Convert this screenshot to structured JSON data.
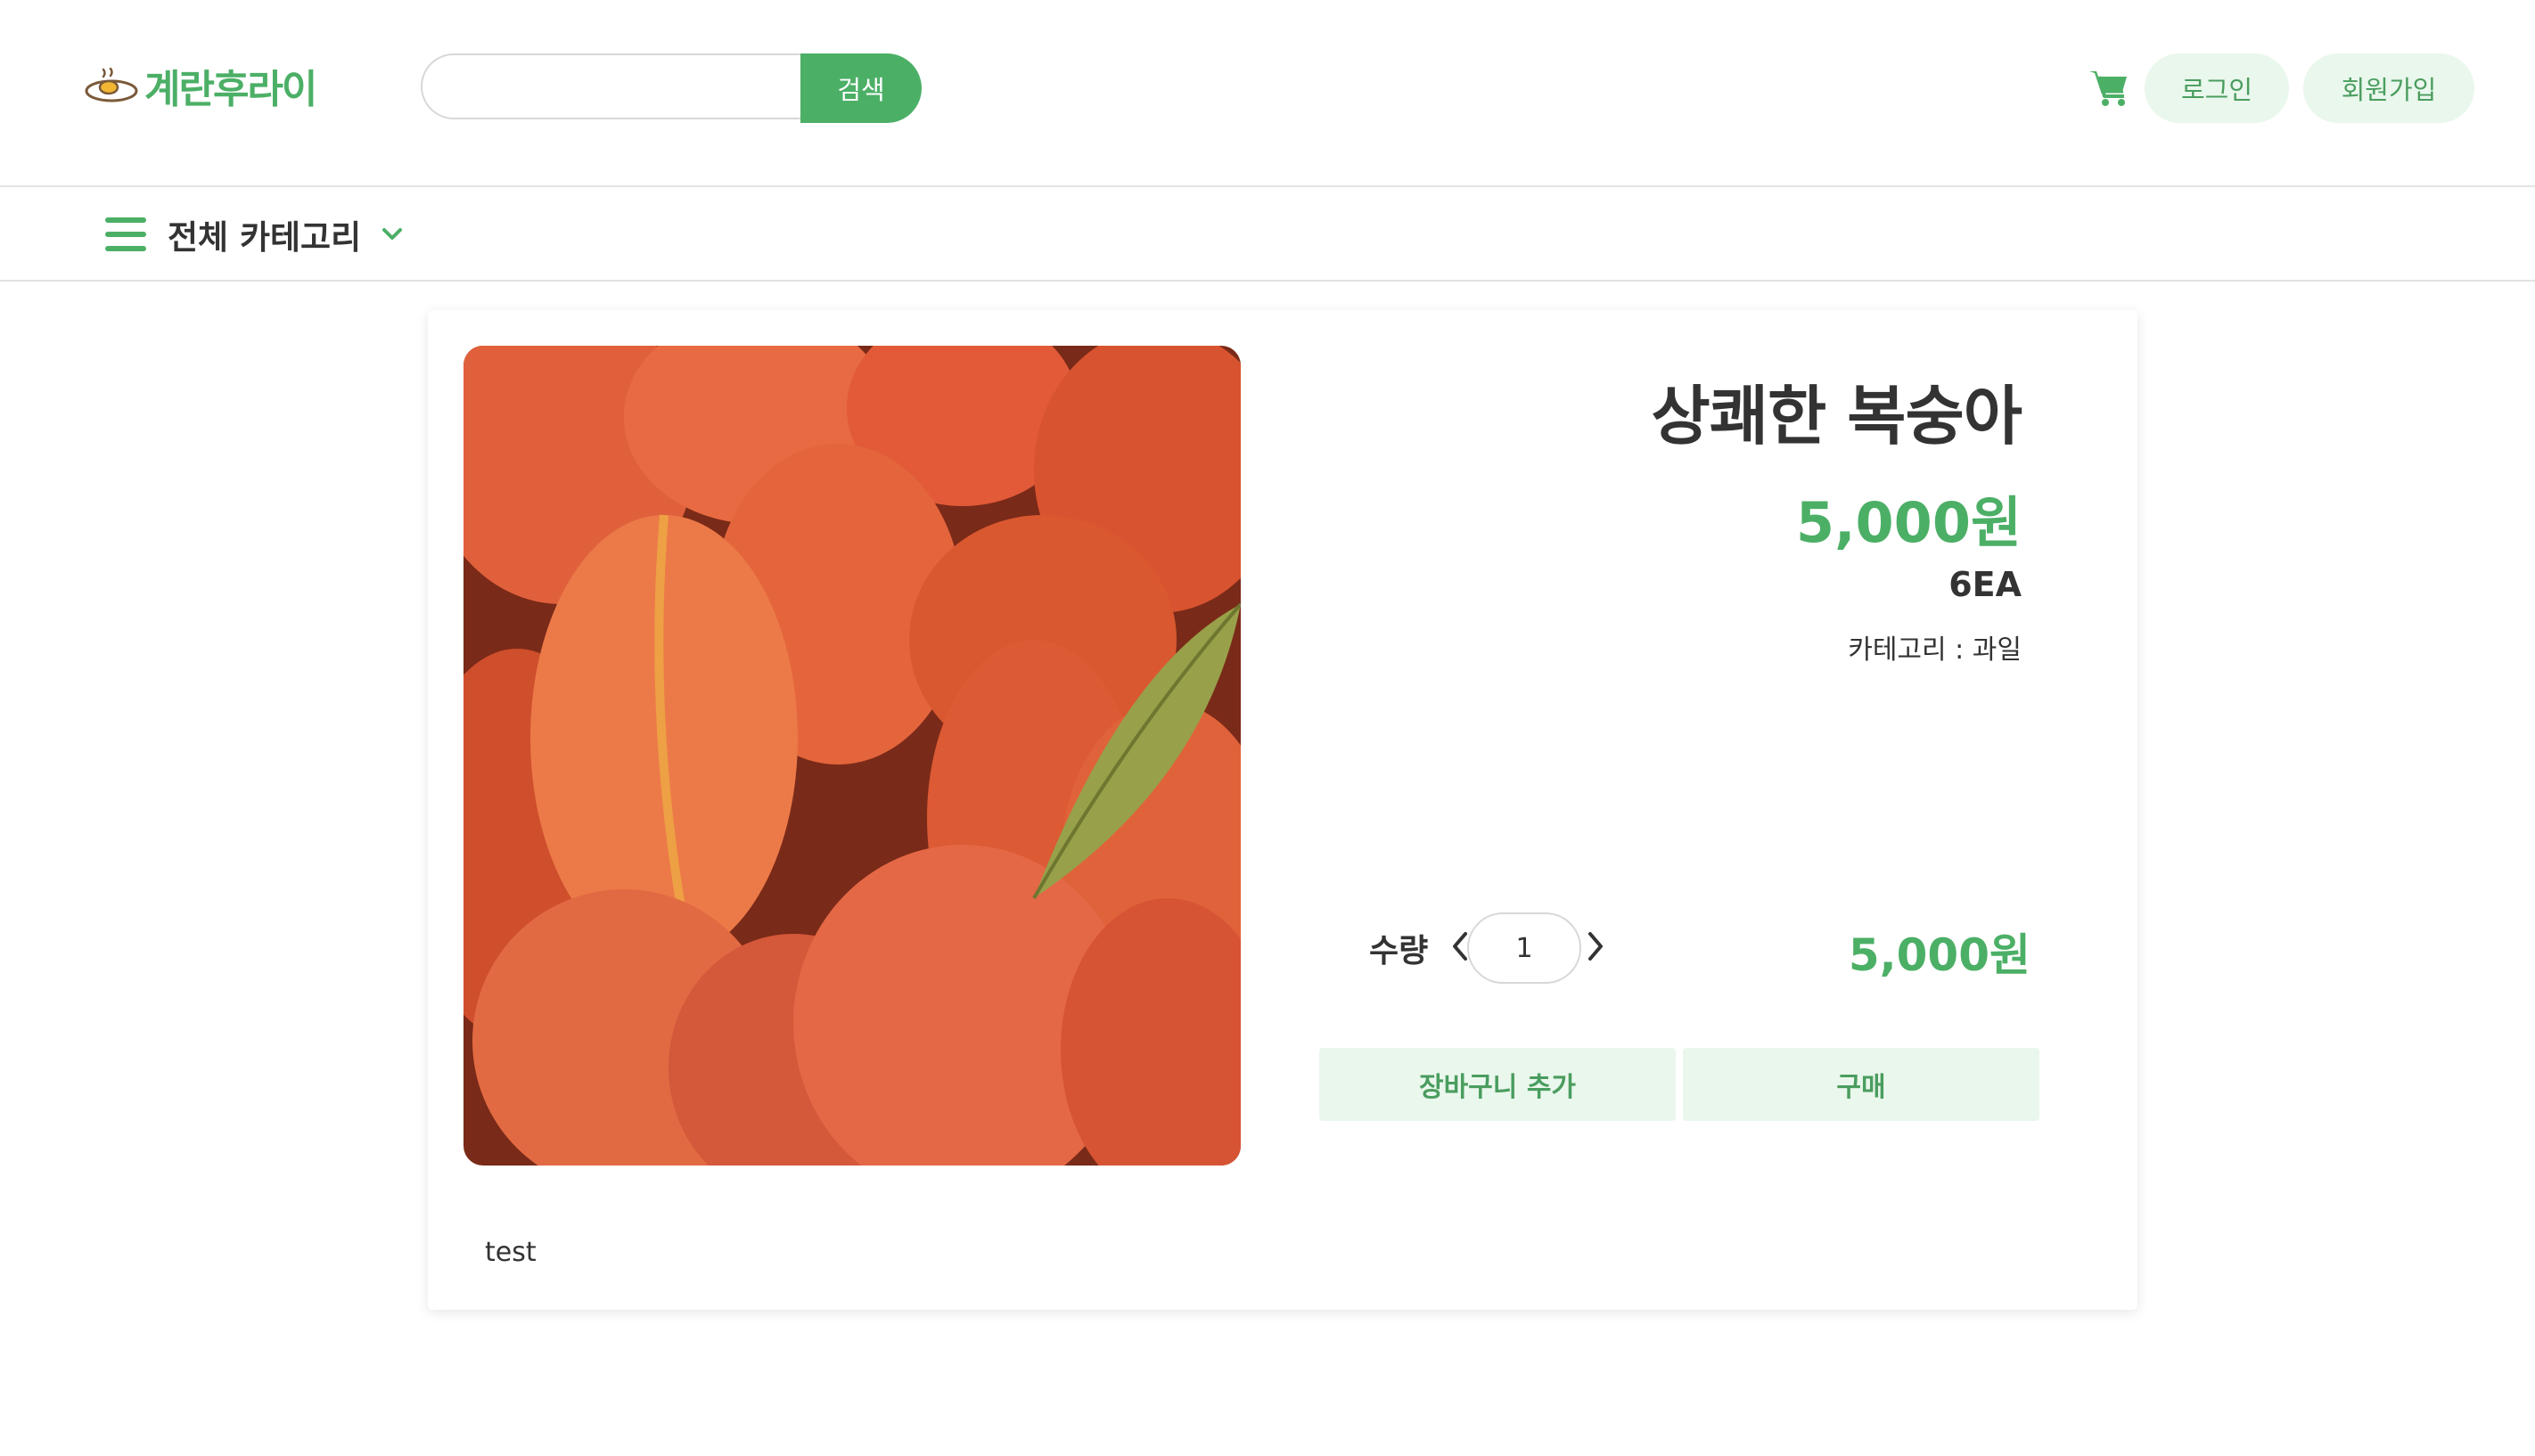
{
  "header": {
    "logo_text": "계란후라이",
    "search": {
      "placeholder": "",
      "value": "",
      "button_label": "검색"
    },
    "login_label": "로그인",
    "signup_label": "회원가입"
  },
  "category_bar": {
    "label": "전체 카테고리"
  },
  "product": {
    "name": "상쾌한 복숭아",
    "price": "5,000원",
    "unit": "6EA",
    "category": "카테고리 : 과일",
    "quantity_label": "수량",
    "quantity": "1",
    "total_price": "5,000원",
    "add_to_cart_label": "장바구니 추가",
    "buy_label": "구매",
    "description": "test"
  },
  "colors": {
    "accent": "#4caf66",
    "pill_bg": "#eaf7ec",
    "text": "#333333"
  },
  "icons": {
    "logo": "fried-egg-icon",
    "cart": "shopping-cart-icon",
    "menu": "hamburger-icon",
    "dropdown": "chevron-down-icon",
    "prev": "chevron-left-icon",
    "next": "chevron-right-icon"
  }
}
